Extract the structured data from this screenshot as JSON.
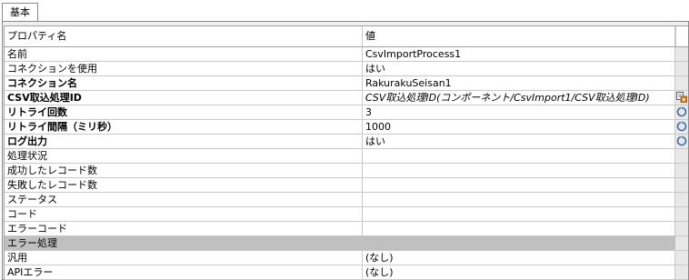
{
  "tab": {
    "label": "基本"
  },
  "grid": {
    "header": {
      "name": "プロパティ名",
      "value": "値"
    },
    "rows": [
      {
        "name": "名前",
        "value": "CsvImportProcess1"
      },
      {
        "name": "コネクションを使用",
        "value": "はい"
      },
      {
        "name": "コネクション名",
        "value": "RakurakuSeisan1"
      },
      {
        "name": "CSV取込処理ID",
        "value": "CSV取込処理ID(コンポーネント/CsvImport1/CSV取込処理ID)",
        "button_icon": "edit-reference-icon"
      },
      {
        "name": "リトライ回数",
        "value": "3",
        "button_icon": "reset-icon"
      },
      {
        "name": "リトライ間隔（ミリ秒）",
        "value": "1000",
        "button_icon": "reset-icon"
      },
      {
        "name": "ログ出力",
        "value": "はい",
        "button_icon": "reset-icon"
      },
      {
        "name": "処理状況",
        "value": ""
      },
      {
        "name": "成功したレコード数",
        "value": ""
      },
      {
        "name": "失敗したレコード数",
        "value": ""
      },
      {
        "name": "ステータス",
        "value": ""
      },
      {
        "name": "コード",
        "value": ""
      },
      {
        "name": "エラーコード",
        "value": ""
      }
    ],
    "category": {
      "name": "エラー処理"
    },
    "error_rows": [
      {
        "name": "汎用",
        "value": "(なし)"
      },
      {
        "name": "APIエラー",
        "value": "(なし)"
      }
    ]
  },
  "colors": {
    "category_bg": "#c0c0c0",
    "button_col_bg": "#e8e8e8",
    "reset_icon_blue": "#3a6ea5",
    "edit_icon_orange": "#e07b1a"
  }
}
